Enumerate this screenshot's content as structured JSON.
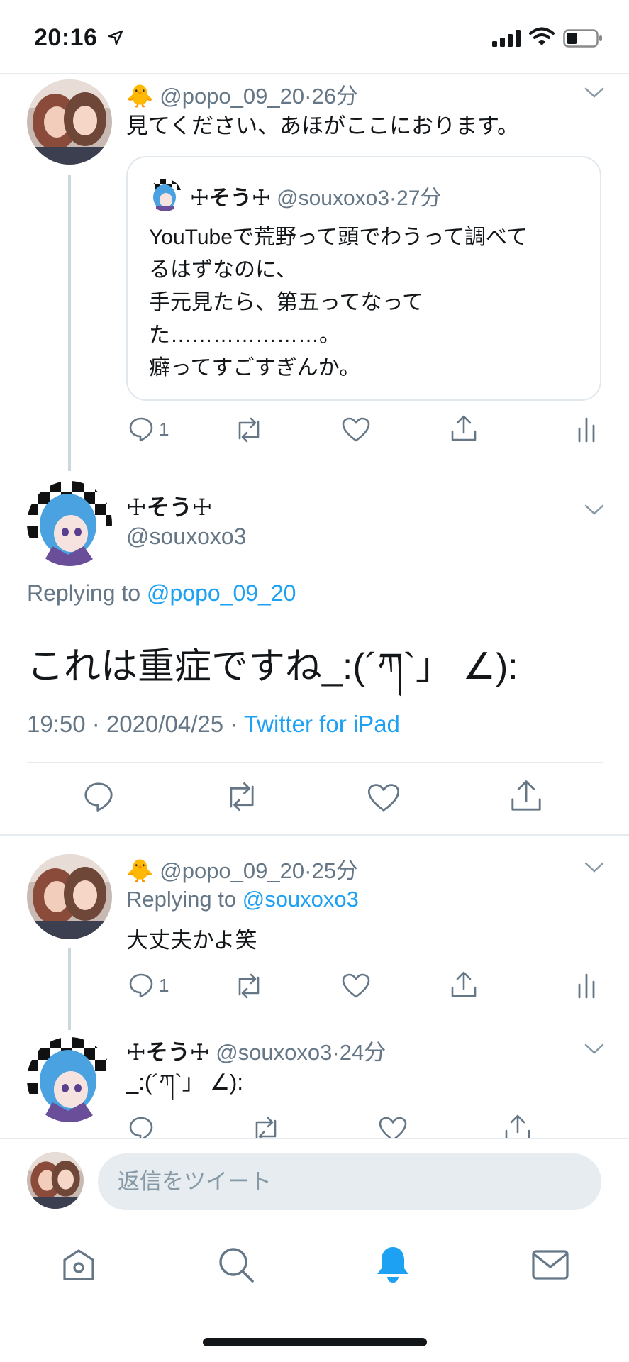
{
  "status_bar": {
    "time": "20:16"
  },
  "tweet1": {
    "emoji": "🐥",
    "handle": "@popo_09_20",
    "sep": "·",
    "age": "26分",
    "text": "見てください、あほがここにおります。",
    "quote": {
      "name": "☩そう☩",
      "handle": "@souxoxo3",
      "sep": "·",
      "age": "27分",
      "lines": [
        "YouTubeで荒野って頭でわうって調べて",
        "るはずなのに、",
        "手元見たら、第五ってなって",
        "た…………………。",
        "癖ってすごすぎんか。"
      ]
    },
    "reply_count": "1"
  },
  "main_tweet": {
    "name": "☩そう☩",
    "handle": "@souxoxo3",
    "replying_prefix": "Replying to ",
    "replying_to": "@popo_09_20",
    "text": "これは重症ですね_:(´ཀ`」 ∠):",
    "time": "19:50",
    "sep1": " · ",
    "date": "2020/04/25",
    "sep2": " · ",
    "client": "Twitter for iPad"
  },
  "tweet3": {
    "emoji": "🐥",
    "handle": "@popo_09_20",
    "sep": "·",
    "age": "25分",
    "replying_prefix": "Replying to ",
    "replying_to": "@souxoxo3",
    "text": "大丈夫かよ笑",
    "reply_count": "1"
  },
  "tweet4": {
    "name": "☩そう☩",
    "handle": "@souxoxo3",
    "sep": "·",
    "age": "24分",
    "text": "_:(´ཀ`」 ∠):"
  },
  "reply_box": {
    "placeholder": "返信をツイート"
  },
  "colors": {
    "accent": "#1da1f2",
    "secondary_text": "#657786",
    "divider": "#e6ecf0"
  }
}
